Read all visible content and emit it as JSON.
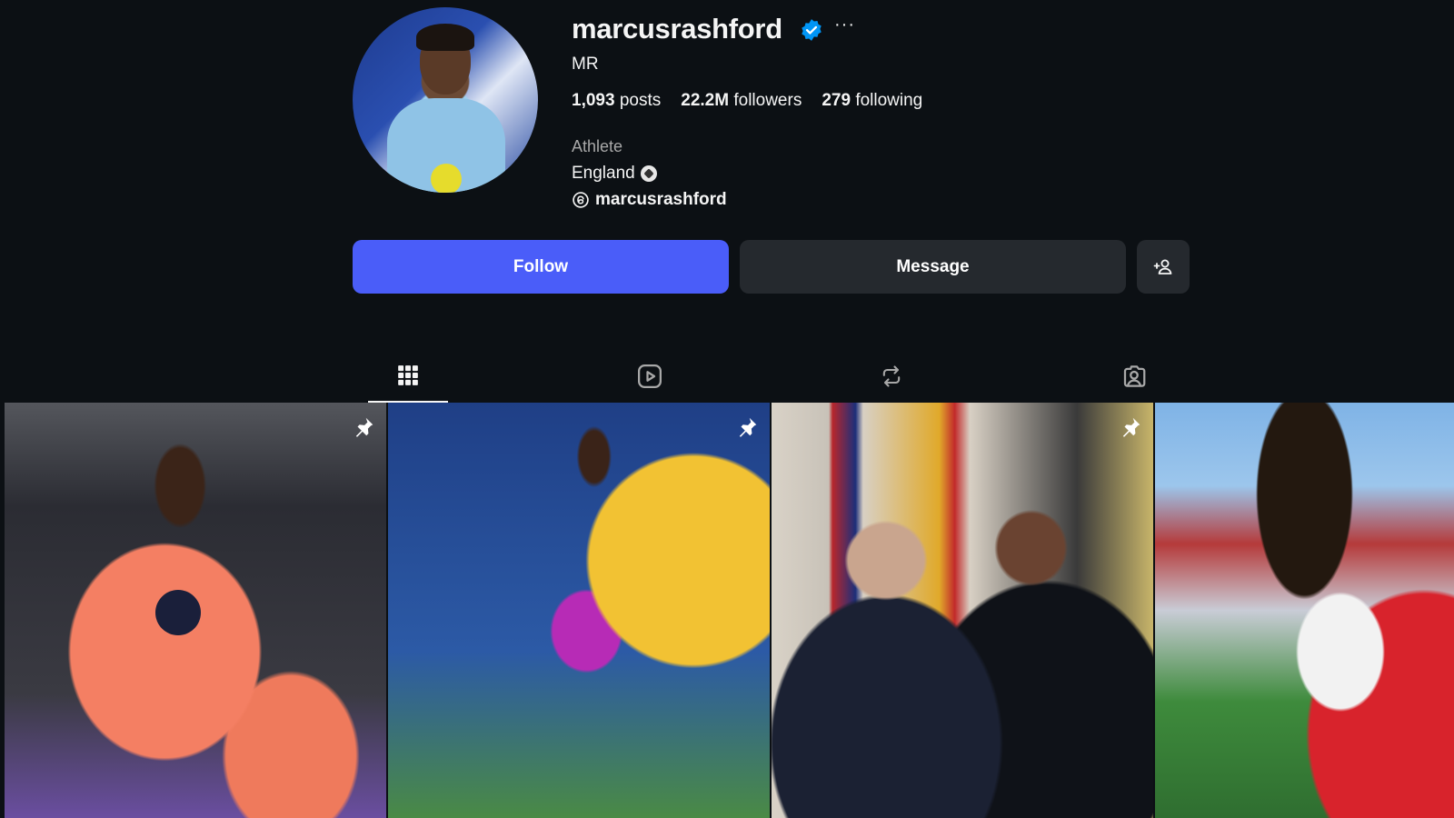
{
  "profile": {
    "username": "marcusrashford",
    "full_name": "MR",
    "posts_count": "1,093",
    "posts_label": "posts",
    "followers_count": "22.2M",
    "followers_label": "followers",
    "following_count": "279",
    "following_label": "following",
    "category": "Athlete",
    "bio_line": "England",
    "threads_handle": "marcusrashford"
  },
  "actions": {
    "follow_label": "Follow",
    "message_label": "Message"
  },
  "tabs": [
    {
      "name": "posts",
      "icon": "grid-icon",
      "active": true
    },
    {
      "name": "reels",
      "icon": "reels-icon",
      "active": false
    },
    {
      "name": "reposts",
      "icon": "repost-icon",
      "active": false
    },
    {
      "name": "tagged",
      "icon": "tagged-icon",
      "active": false
    }
  ],
  "posts": [
    {
      "pinned": true
    },
    {
      "pinned": true
    },
    {
      "pinned": true
    },
    {
      "pinned": false
    }
  ],
  "colors": {
    "background": "#0c1014",
    "follow_button": "#4a5df9",
    "secondary_button": "#25292e",
    "verified": "#0095f6"
  }
}
